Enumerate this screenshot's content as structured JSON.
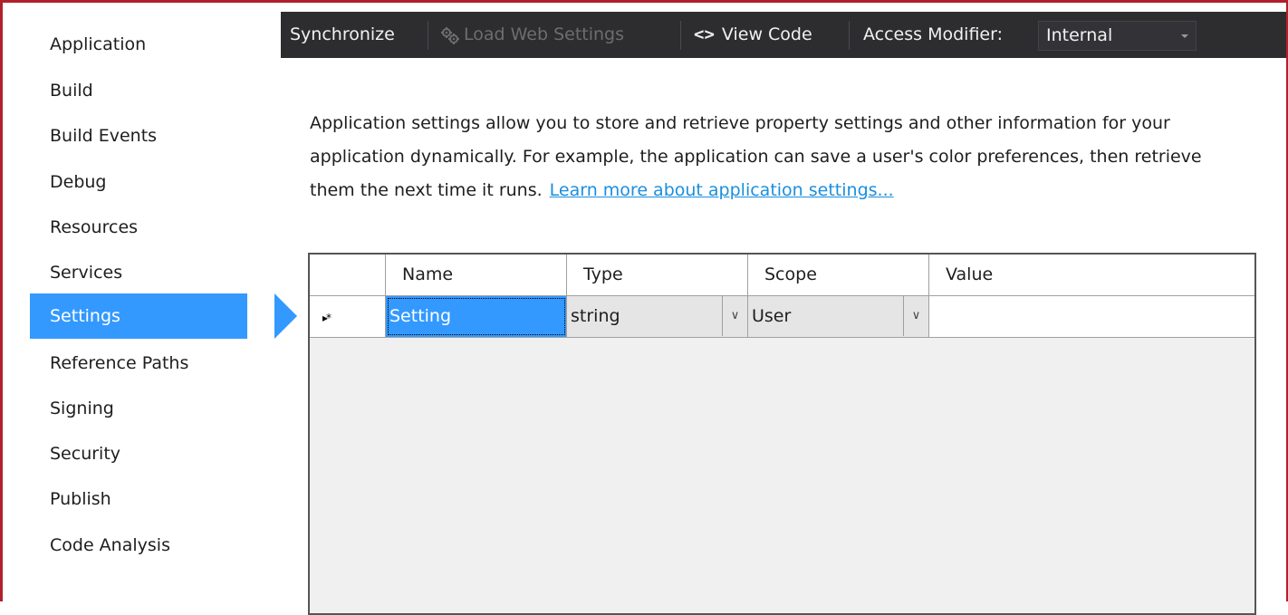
{
  "sidebar": {
    "items": [
      {
        "label": "Application"
      },
      {
        "label": "Build"
      },
      {
        "label": "Build Events"
      },
      {
        "label": "Debug"
      },
      {
        "label": "Resources"
      },
      {
        "label": "Services"
      },
      {
        "label": "Settings",
        "selected": true
      },
      {
        "label": "Reference Paths"
      },
      {
        "label": "Signing"
      },
      {
        "label": "Security"
      },
      {
        "label": "Publish"
      },
      {
        "label": "Code Analysis"
      }
    ]
  },
  "toolbar": {
    "synchronize_label": "Synchronize",
    "load_web_settings_label": "Load Web Settings",
    "view_code_icon": "<>",
    "view_code_label": "View Code",
    "access_modifier_label": "Access Modifier:",
    "access_modifier_value": "Internal"
  },
  "description": {
    "text": "Application settings allow you to store and retrieve property settings and other information for your application dynamically. For example, the application can save a user's color preferences, then retrieve them the next time it runs.",
    "link_text": "Learn more about application settings..."
  },
  "grid": {
    "columns": [
      "",
      "Name",
      "Type",
      "Scope",
      "Value"
    ],
    "new_row": {
      "marker": "▸*",
      "name": "Setting",
      "type": "string",
      "scope": "User",
      "value": ""
    }
  },
  "colors": {
    "accent": "#3399ff",
    "toolbar_bg": "#2d2d30",
    "link": "#1a8fde",
    "frame": "#b0202c"
  }
}
